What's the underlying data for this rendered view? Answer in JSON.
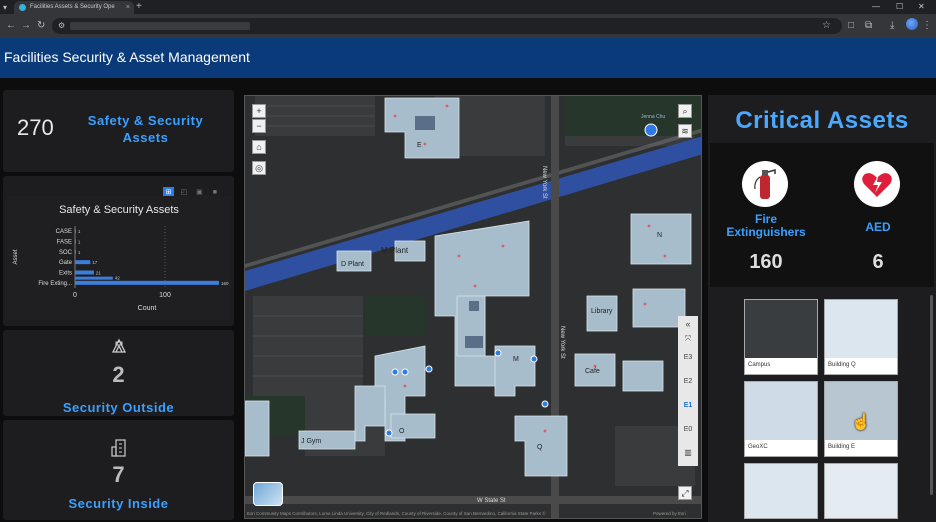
{
  "browser": {
    "tab_title": "Facilities Assets & Security Ope",
    "tab_close": "×",
    "new_tab": "+",
    "window_controls": [
      "—",
      "☐",
      "✕"
    ]
  },
  "app": {
    "title": "Facilities Security & Asset Management"
  },
  "left": {
    "total": {
      "value": "270",
      "label_line1": "Safety & Security",
      "label_line2": "Assets"
    },
    "chart_title": "Safety & Security Assets",
    "security_outside": {
      "value": "2",
      "label": "Security Outside"
    },
    "security_inside": {
      "value": "7",
      "label": "Security Inside"
    }
  },
  "chart_data": {
    "type": "bar",
    "orientation": "horizontal",
    "title": "Safety & Security Assets",
    "xlabel": "Count",
    "ylabel": "Asset",
    "categories": [
      "CASE",
      "FASE",
      "SOC",
      "Gate",
      "Exits",
      "Fire Exting..."
    ],
    "values": [
      1,
      1,
      1,
      17,
      21,
      160
    ],
    "value_labels": [
      "1",
      "1",
      "1",
      "17",
      "21",
      "160"
    ],
    "partial_bar": {
      "value": 42,
      "label": "42"
    },
    "xlim": [
      0,
      160
    ],
    "xticks": [
      "0",
      "100"
    ],
    "color": "#3b7ddd"
  },
  "map": {
    "street_labels": [
      "New York St",
      "W State St",
      "M Plant",
      "Library",
      "Cafe",
      "J Gym",
      "N",
      "E",
      "Q",
      "M",
      "O",
      "D Plant",
      "Jenna Chu"
    ],
    "attribution": "Esri Community Maps Contributors, Loma Linda University, City of Redlands, County of Riverside, County of San Bernardino, California State Parks ©",
    "powered": "Powered by Esri",
    "floors": [
      "E3",
      "E2",
      "E1",
      "E0"
    ],
    "active_floor": "E1",
    "zoom_in": "+",
    "zoom_out": "−"
  },
  "assets": {
    "title": "Critical Assets",
    "fire": {
      "name_line1": "Fire",
      "name_line2": "Extinguishers",
      "value": "160"
    },
    "aed": {
      "name": "AED",
      "value": "6"
    },
    "thumbnails": [
      "Campus",
      "Building Q",
      "GeoXC",
      "Building E"
    ]
  },
  "colors": {
    "accent": "#3aa0ff",
    "header": "#0a3a7a",
    "road": "#2f4fa0"
  }
}
